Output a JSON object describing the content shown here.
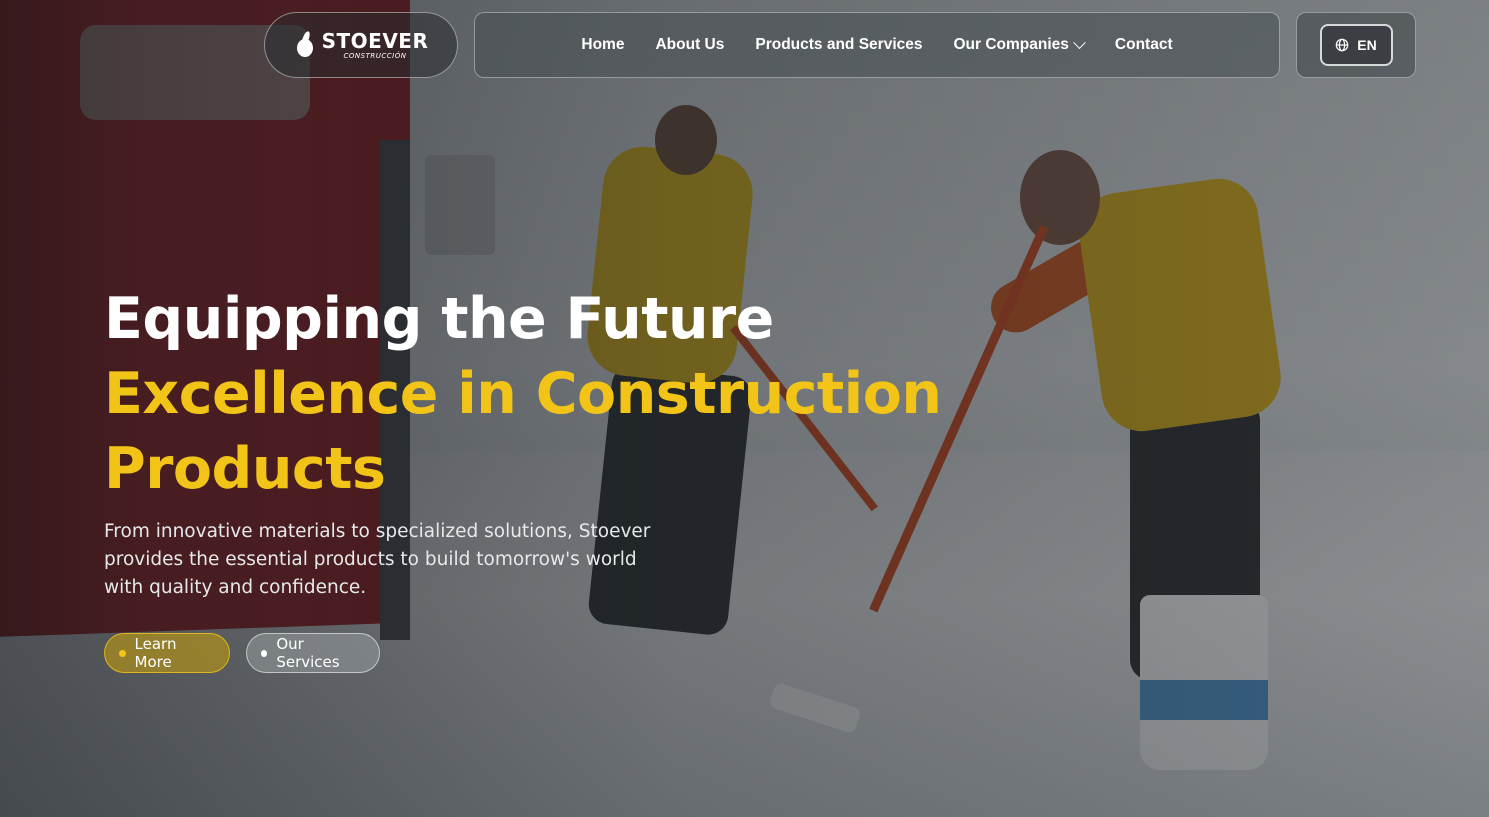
{
  "brand": {
    "name": "STOEVER",
    "subtitle": "CONSTRUCCIÓN",
    "icon": "flame-drop-logo"
  },
  "nav": {
    "items": [
      {
        "label": "Home"
      },
      {
        "label": "About Us"
      },
      {
        "label": "Products and Services"
      },
      {
        "label": "Our Companies",
        "has_dropdown": true
      },
      {
        "label": "Contact"
      }
    ]
  },
  "language": {
    "current": "EN",
    "icon": "globe-icon"
  },
  "hero": {
    "line1": "Equipping the Future",
    "line2": "Excellence in Construction",
    "line3": "Products",
    "description": "From innovative materials to specialized solutions, Stoever provides the essential products to build tomorrow's world with quality and confidence.",
    "primary_button": "Learn More",
    "secondary_button": "Our Services"
  },
  "colors": {
    "accent": "#f2c418",
    "text": "#ffffff"
  }
}
